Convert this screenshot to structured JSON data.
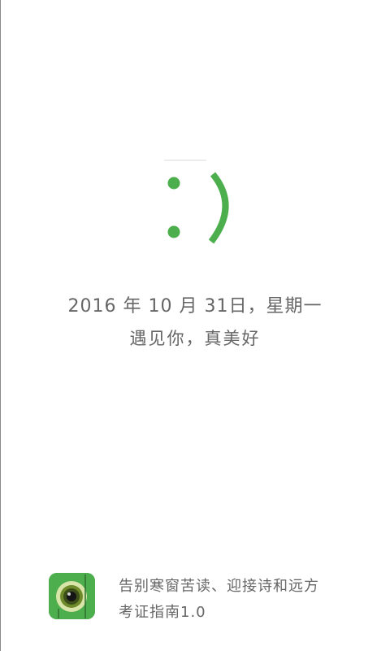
{
  "splash": {
    "date_text": "2016 年 10 月 31日，星期一",
    "greeting": "遇见你，真美好",
    "smiley_icon": "smiley-face-icon",
    "accent_color": "#4cae4c"
  },
  "footer": {
    "app_icon": "camera-eye-icon",
    "slogan": "告别寒窗苦读、迎接诗和远方",
    "app_name": "考证指南1.0"
  }
}
